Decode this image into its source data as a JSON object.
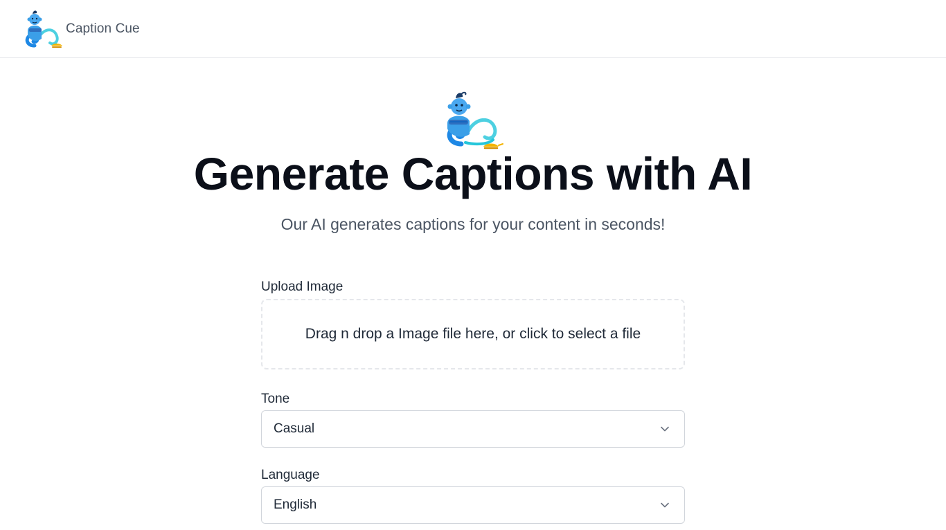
{
  "header": {
    "brand_name": "Caption Cue",
    "logo_icon": "genie-icon"
  },
  "hero": {
    "icon": "genie-icon",
    "title": "Generate Captions with AI",
    "subtitle": "Our AI generates captions for your content in seconds!"
  },
  "form": {
    "upload": {
      "label": "Upload Image",
      "dropzone_text": "Drag n drop a Image file here, or click to select a file"
    },
    "tone": {
      "label": "Tone",
      "selected": "Casual"
    },
    "language": {
      "label": "Language",
      "selected": "English"
    }
  },
  "colors": {
    "title": "#0b0f19",
    "muted_text": "#4b5563",
    "border": "#d1d5db",
    "genie_blue": "#3b9fe8",
    "genie_gold": "#f4b400"
  }
}
